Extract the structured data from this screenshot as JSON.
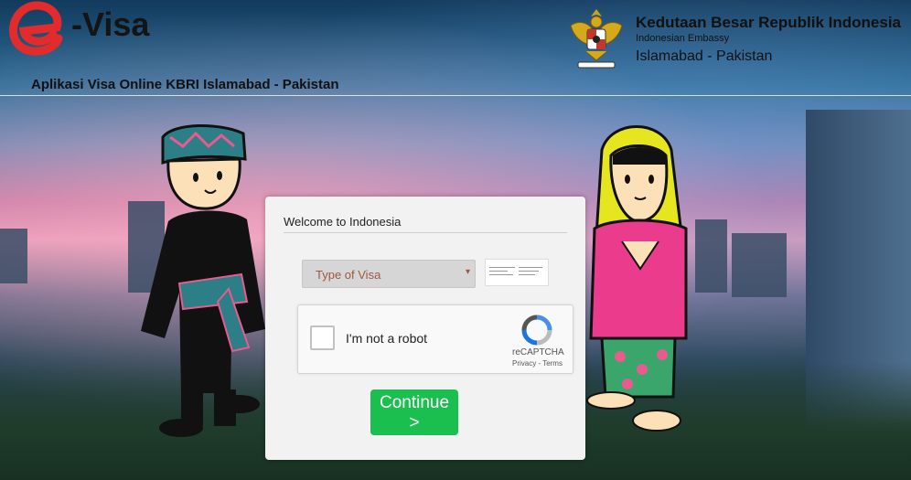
{
  "header": {
    "logo_letter": "e",
    "logo_text": "-Visa",
    "app_subtitle": "Aplikasi Visa Online KBRI Islamabad - Pakistan",
    "embassy_title": "Kedutaan Besar Republik Indonesia",
    "embassy_subtitle": "Indonesian Embassy",
    "embassy_city": "Islamabad - Pakistan",
    "emblem_icon": "garuda-emblem-icon"
  },
  "form": {
    "welcome": "Welcome to Indonesia",
    "visa_select": {
      "selected": "Type of Visa",
      "arrow": "▾"
    },
    "captcha": {
      "label": "I'm not a robot",
      "brand": "reCAPTCHA",
      "links": "Privacy - Terms",
      "checked": false
    },
    "continue_label": "Continue\n>"
  },
  "colors": {
    "accent_red": "#e32b2b",
    "button_green": "#1bbf4f",
    "select_text": "#9c5a3c"
  }
}
